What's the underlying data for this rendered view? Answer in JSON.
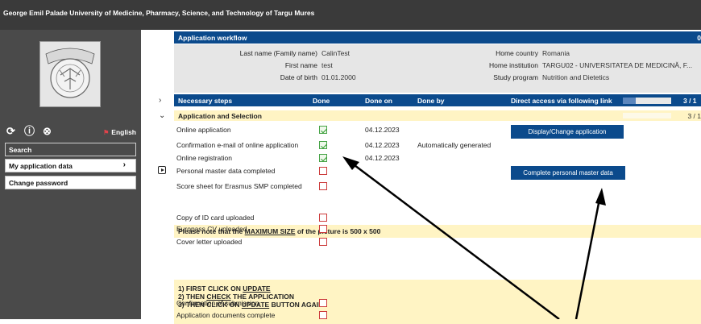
{
  "app": {
    "title": "George Emil Palade University of Medicine, Pharmacy, Science, and Technology of Targu Mures"
  },
  "sidebar": {
    "language": "English",
    "search_label": "Search",
    "items": [
      {
        "label": "My application data",
        "has_chevron": true
      },
      {
        "label": "Change password",
        "has_chevron": false
      }
    ],
    "icons": [
      "refresh-icon",
      "help-icon",
      "close-icon",
      "flag-icon",
      "play-icon"
    ]
  },
  "workflow": {
    "title": "Application workflow",
    "header_counter": "0",
    "person": [
      {
        "label": "Last name (Family name)",
        "value": "CalinTest"
      },
      {
        "label": "First name",
        "value": "test"
      },
      {
        "label": "Date of birth",
        "value": "01.01.2000"
      }
    ],
    "institution": [
      {
        "label": "Home country",
        "value": "Romania"
      },
      {
        "label": "Home institution",
        "value": "TARGU02 - UNIVERSITATEA DE MEDICINĂ, F..."
      },
      {
        "label": "Study program",
        "value": "Nutrition and Dietetics"
      }
    ]
  },
  "steps_table": {
    "columns": [
      "Necessary steps",
      "Done",
      "Done on",
      "Done by",
      "Direct access via following link"
    ],
    "progress_text": "3 / 1",
    "progress_fraction": 0.27
  },
  "section": {
    "title": "Application and Selection",
    "progress_text": "3 / 1"
  },
  "steps": [
    {
      "name": "Online application",
      "done": true,
      "done_on": "04.12.2023",
      "done_by": ""
    },
    {
      "name": "Confirmation e-mail of online application",
      "done": true,
      "done_on": "04.12.2023",
      "done_by": "Automatically generated"
    },
    {
      "name": "Online registration",
      "done": true,
      "done_on": "04.12.2023",
      "done_by": ""
    },
    {
      "name": "Personal master data completed",
      "done": false,
      "done_on": "",
      "done_by": ""
    },
    {
      "name": "Score sheet for Erasmus SMP completed",
      "done": false,
      "done_on": "",
      "done_by": ""
    },
    {
      "name": "Copy of ID card uploaded",
      "done": false,
      "done_on": "",
      "done_by": ""
    },
    {
      "name": "Europass CV uploaded",
      "done": false,
      "done_on": "",
      "done_by": ""
    },
    {
      "name": "Cover letter uploaded",
      "done": false,
      "done_on": "",
      "done_by": ""
    },
    {
      "name": "Confirmation of submission",
      "done": false,
      "done_on": "",
      "done_by": ""
    },
    {
      "name": "Application documents complete",
      "done": false,
      "done_on": "",
      "done_by": ""
    }
  ],
  "buttons": {
    "display_change": "Display/Change application",
    "complete_master": "Complete personal master data"
  },
  "notes": {
    "picture_size": {
      "before": "Please note that the ",
      "emphasis": "MAXIMUM SIZE",
      "after": " of the picture is 500 x 500"
    },
    "instructions": {
      "line1_pre": "1) FIRST CLICK ON ",
      "line1_u": "UPDATE",
      "line2_pre": "2) THEN ",
      "line2_u": "CHECK",
      "line2_post": " THE APPLICATION",
      "line3_pre": "3) THEN CLICK ON ",
      "line3_u": "UPDATE",
      "line3_post": " BUTTON AGAIN"
    }
  },
  "colors": {
    "header_blue": "#0b4a8c",
    "sidebar_gray": "#4a4a4a",
    "note_yellow": "#fff4c4",
    "check_green": "#2f9b2f",
    "box_red": "#cc3b3b"
  }
}
